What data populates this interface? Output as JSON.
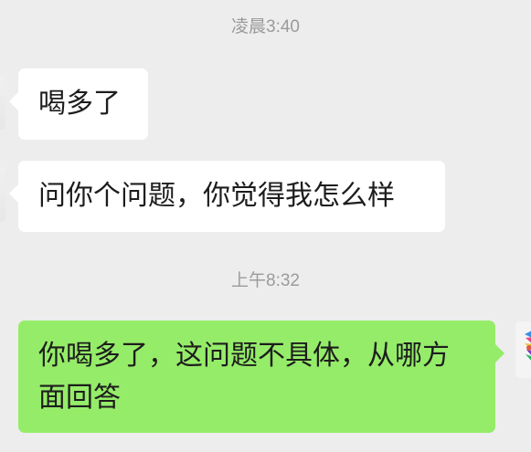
{
  "chat": {
    "time_1": "凌晨3:40",
    "msg_1": "喝多了",
    "msg_2": "问你个问题，你觉得我怎么样",
    "time_2": "上午8:32",
    "msg_3": "你喝多了，这问题不具体，从哪方面回答"
  },
  "colors": {
    "background": "#ededed",
    "incoming_bubble": "#ffffff",
    "outgoing_bubble": "#95ec69",
    "timestamp_text": "#9b9b9b"
  },
  "icons": {
    "my_avatar": "colorful-avatar-icon"
  }
}
